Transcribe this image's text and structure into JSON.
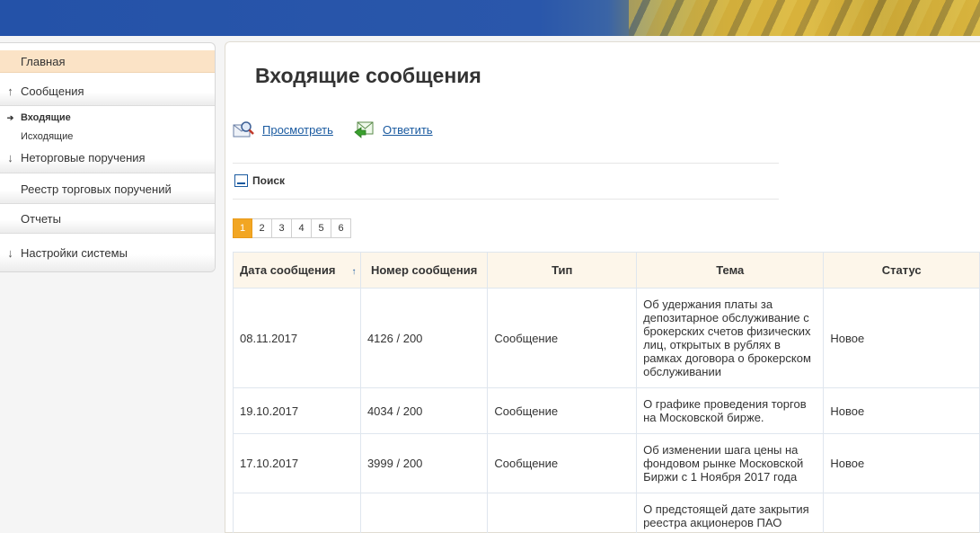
{
  "sidebar": {
    "items": [
      {
        "label": "Главная",
        "arrow": ""
      },
      {
        "label": "Сообщения",
        "arrow": "↑"
      },
      {
        "label": "Неторговые поручения",
        "arrow": "↓"
      },
      {
        "label": "Реестр торговых поручений",
        "arrow": ""
      },
      {
        "label": "Отчеты",
        "arrow": ""
      },
      {
        "label": "Настройки системы",
        "arrow": "↓"
      }
    ],
    "subitems": [
      {
        "label": "Входящие",
        "bullet": "➔"
      },
      {
        "label": "Исходящие",
        "bullet": ""
      }
    ]
  },
  "main": {
    "title": "Входящие сообщения",
    "actions": {
      "view": "Просмотреть",
      "reply": "Ответить"
    },
    "search_label": "Поиск",
    "pages": [
      "1",
      "2",
      "3",
      "4",
      "5",
      "6"
    ],
    "active_page": "1",
    "table": {
      "headers": [
        "Дата сообщения",
        "Номер сообщения",
        "Тип",
        "Тема",
        "Статус"
      ],
      "sort_indicator": "↑",
      "rows": [
        {
          "date": "08.11.2017",
          "number": "4126 / 200",
          "type": "Сообщение",
          "topic_lines": [
            "Об удержания платы за",
            "депозитарное обслуживание с",
            "брокерских счетов физических",
            "лиц, открытых в рублях в",
            "рамках договора о брокерском",
            "обслуживании"
          ],
          "status": "Новое"
        },
        {
          "date": "19.10.2017",
          "number": "4034 / 200",
          "type": "Сообщение",
          "topic_lines": [
            "О графике проведения торгов",
            "на Московской бирже."
          ],
          "status": "Новое"
        },
        {
          "date": "17.10.2017",
          "number": "3999 / 200",
          "type": "Сообщение",
          "topic_lines": [
            "Об изменении шага цены на",
            "фондовом рынке Московской",
            "Биржи с 1 Ноября 2017 года"
          ],
          "status": "Новое"
        },
        {
          "date": "",
          "number": "",
          "type": "",
          "topic_lines": [
            "О предстоящей дате закрытия",
            "реестра акционеров ПАО"
          ],
          "status": ""
        }
      ]
    }
  },
  "colors": {
    "accent": "#f2a623",
    "link": "#1a5aa0",
    "header_blue": "#2452a8",
    "active_nav": "#fbe3c6"
  }
}
